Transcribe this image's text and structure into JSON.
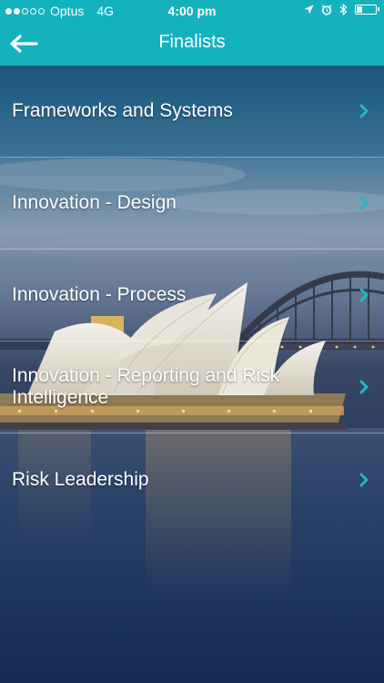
{
  "status_bar": {
    "carrier": "Optus",
    "network": "4G",
    "time": "4:00 pm",
    "signal_bars": 2,
    "signal_total": 5
  },
  "nav": {
    "title": "Finalists",
    "back_icon": "back-arrow-icon"
  },
  "colors": {
    "accent": "#14b2bd",
    "chevron": "#1fb8c6",
    "text": "#ffffff"
  },
  "list": {
    "items": [
      {
        "label": "Frameworks and Systems"
      },
      {
        "label": "Innovation - Design"
      },
      {
        "label": "Innovation - Process"
      },
      {
        "label": "Innovation - Reporting and Risk Intelligence"
      },
      {
        "label": "Risk Leadership"
      }
    ]
  }
}
